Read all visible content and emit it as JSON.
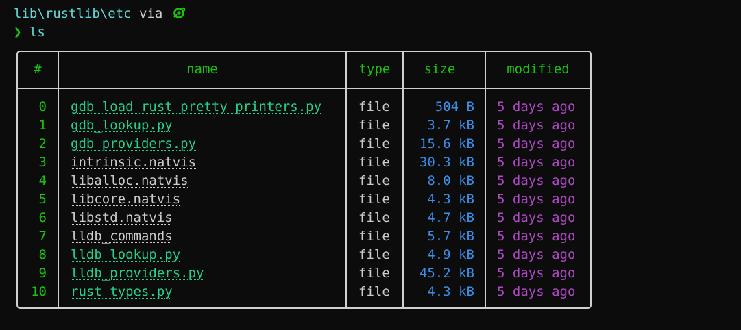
{
  "prompt": {
    "path": "lib\\rustlib\\etc",
    "via": " via ",
    "icon": "rust-icon",
    "symbol": "❯",
    "command": "ls"
  },
  "table": {
    "headers": [
      "#",
      "name",
      "type",
      "size",
      "modified"
    ],
    "rows": [
      {
        "index": "0",
        "name": "gdb_load_rust_pretty_printers.py",
        "type": "file",
        "size": "504 B",
        "modified": "5 days ago",
        "kind": "py"
      },
      {
        "index": "1",
        "name": "gdb_lookup.py",
        "type": "file",
        "size": "3.7 kB",
        "modified": "5 days ago",
        "kind": "py"
      },
      {
        "index": "2",
        "name": "gdb_providers.py",
        "type": "file",
        "size": "15.6 kB",
        "modified": "5 days ago",
        "kind": "py"
      },
      {
        "index": "3",
        "name": "intrinsic.natvis",
        "type": "file",
        "size": "30.3 kB",
        "modified": "5 days ago",
        "kind": "other"
      },
      {
        "index": "4",
        "name": "liballoc.natvis",
        "type": "file",
        "size": "8.0 kB",
        "modified": "5 days ago",
        "kind": "other"
      },
      {
        "index": "5",
        "name": "libcore.natvis",
        "type": "file",
        "size": "4.3 kB",
        "modified": "5 days ago",
        "kind": "other"
      },
      {
        "index": "6",
        "name": "libstd.natvis",
        "type": "file",
        "size": "4.7 kB",
        "modified": "5 days ago",
        "kind": "other"
      },
      {
        "index": "7",
        "name": "lldb_commands",
        "type": "file",
        "size": "5.7 kB",
        "modified": "5 days ago",
        "kind": "other"
      },
      {
        "index": "8",
        "name": "lldb_lookup.py",
        "type": "file",
        "size": "4.9 kB",
        "modified": "5 days ago",
        "kind": "py"
      },
      {
        "index": "9",
        "name": "lldb_providers.py",
        "type": "file",
        "size": "45.2 kB",
        "modified": "5 days ago",
        "kind": "py"
      },
      {
        "index": "10",
        "name": "rust_types.py",
        "type": "file",
        "size": "4.3 kB",
        "modified": "5 days ago",
        "kind": "py"
      }
    ]
  },
  "colors": {
    "background": "#0c0c0c",
    "path": "#61d6d6",
    "index": "#16c60c",
    "header": "#16c60c",
    "py_name": "#23d18b",
    "other_name": "#cccccc",
    "size": "#3b8eea",
    "modified": "#b148c6"
  }
}
